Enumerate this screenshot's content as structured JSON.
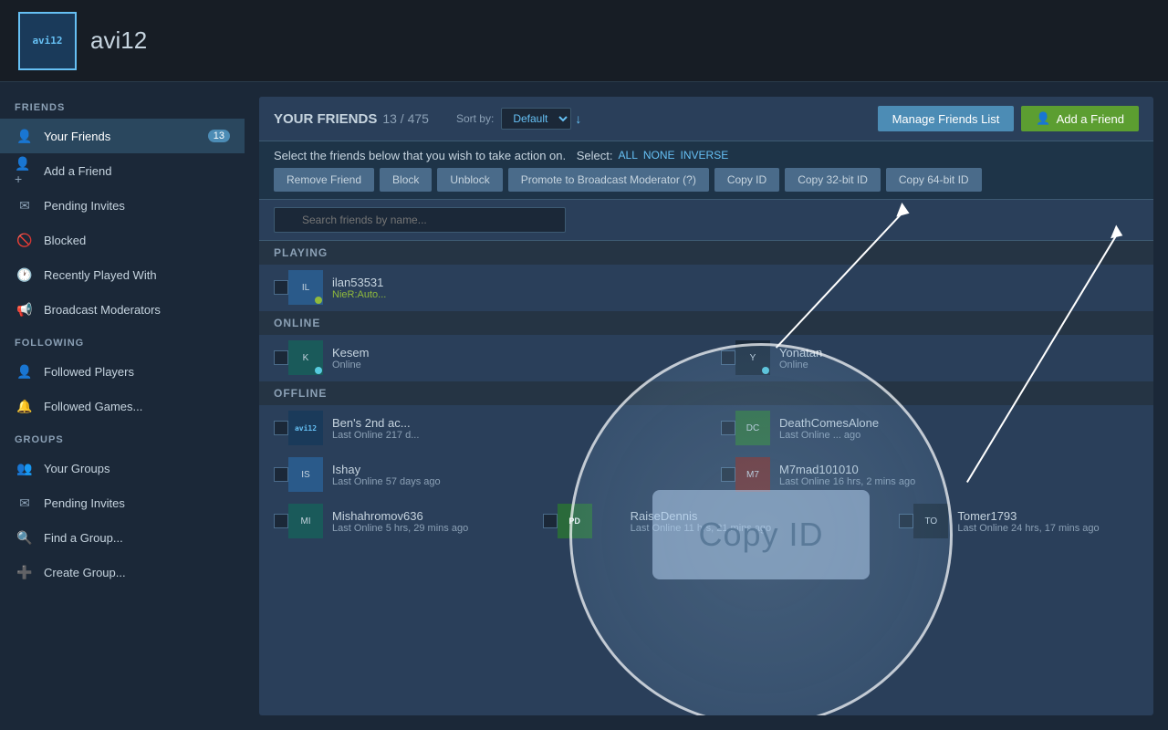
{
  "header": {
    "avatar_text": "avi12",
    "username": "avi12"
  },
  "sidebar": {
    "friends_label": "FRIENDS",
    "following_label": "FOLLOWING",
    "groups_label": "GROUPS",
    "friends_items": [
      {
        "label": "Your Friends",
        "badge": "13",
        "active": true
      },
      {
        "label": "Add a Friend",
        "badge": null
      },
      {
        "label": "Pending Invites",
        "badge": null
      },
      {
        "label": "Blocked",
        "badge": null
      },
      {
        "label": "Recently Played With",
        "badge": null
      },
      {
        "label": "Broadcast Moderators",
        "badge": null
      }
    ],
    "following_items": [
      {
        "label": "Followed Players"
      },
      {
        "label": "Followed Games..."
      }
    ],
    "groups_items": [
      {
        "label": "Your Groups"
      },
      {
        "label": "Pending Invites"
      },
      {
        "label": "Find a Group..."
      },
      {
        "label": "Create Group..."
      }
    ]
  },
  "main": {
    "title": "YOUR FRIENDS",
    "count": "13 / 475",
    "sort_label": "Sort by:",
    "sort_value": "Default",
    "manage_btn": "Manage Friends List",
    "add_btn": "Add a Friend",
    "select_instruction": "Select the friends below that you wish to take action on.",
    "select_label": "Select:",
    "select_all": "ALL",
    "select_none": "NONE",
    "select_inverse": "INVERSE",
    "action_buttons": [
      "Remove Friend",
      "Block",
      "Unblock",
      "Promote to Broadcast Moderator (?)",
      "Copy ID",
      "Copy 32-bit ID",
      "Copy 64-bit ID"
    ],
    "search_placeholder": "Search friends by name...",
    "sections": {
      "playing": "PLAYING",
      "online": "ONLINE",
      "offline": "OFFLINE"
    },
    "friends": {
      "playing": [
        {
          "name": "ilan53531",
          "status": "NieR:Auto...",
          "avatar_color": "av-blue",
          "avatar_text": "IL"
        }
      ],
      "online": [
        {
          "name": "Kesem",
          "status": "Online",
          "avatar_color": "av-teal",
          "avatar_text": "K",
          "col": "left"
        },
        {
          "name": "Yonatan",
          "status": "Online",
          "avatar_color": "av-dark",
          "avatar_text": "Y",
          "col": "right"
        }
      ],
      "offline": [
        {
          "name": "Ben's 2nd ac...",
          "status": "Last Online 217 d...",
          "avatar_color": "av-avi12",
          "avatar_text": "avi12",
          "col": "left"
        },
        {
          "name": "DeathComesAlone",
          "status": "Last Online ... ago",
          "avatar_color": "av-green",
          "avatar_text": "DC",
          "col": "right"
        },
        {
          "name": "Ishay",
          "status": "Last Online 57 days ago",
          "avatar_color": "av-blue",
          "avatar_text": "IS",
          "col": "left"
        },
        {
          "name": "M7mad101010",
          "status": "Last Online 16 hrs, 2 mins ago",
          "avatar_color": "av-red",
          "avatar_text": "M7",
          "col": "right"
        },
        {
          "name": "Mishahromov636",
          "status": "Last Online 5 hrs, 29 mins ago",
          "avatar_color": "av-teal",
          "avatar_text": "MI",
          "col": "left"
        },
        {
          "name": "RaiseDennis",
          "status": "Last Online 11 hrs, 21 mins ago",
          "avatar_color": "av-green",
          "avatar_text": "RD",
          "col": "middle"
        },
        {
          "name": "Tomer1793",
          "status": "Last Online 24 hrs, 17 mins ago",
          "avatar_color": "av-dark",
          "avatar_text": "TO",
          "col": "right"
        }
      ]
    }
  },
  "overlay": {
    "copy_id_label": "Copy ID"
  }
}
